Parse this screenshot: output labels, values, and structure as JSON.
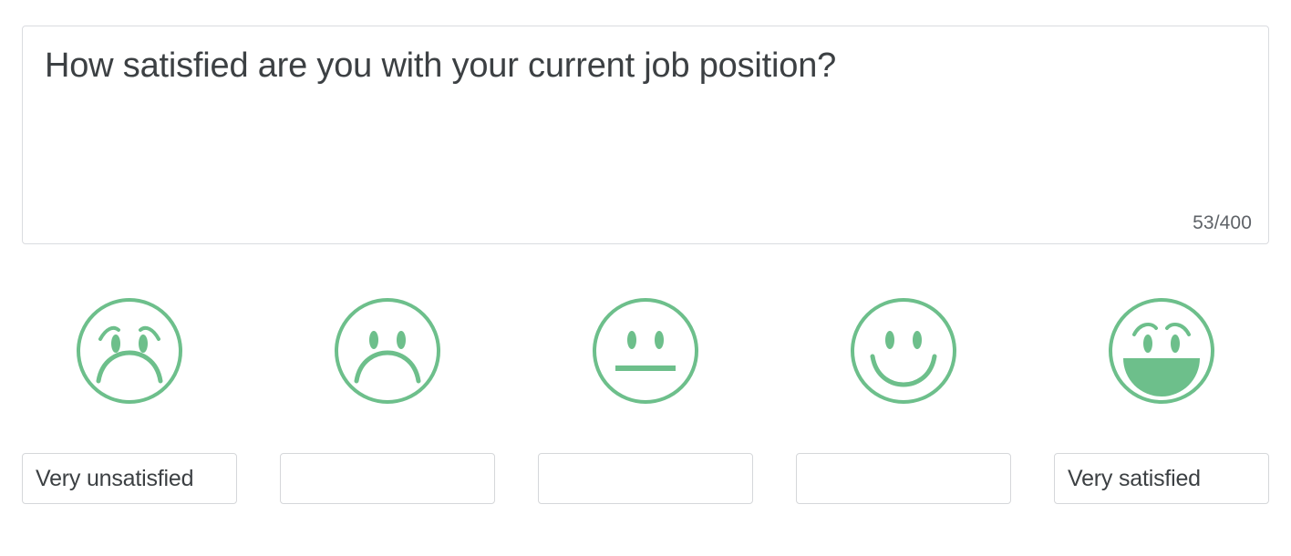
{
  "question": {
    "text": "How satisfied are you with your current job position?",
    "char_counter": "53/400",
    "placeholder": "Enter your question"
  },
  "colors": {
    "face_green": "#6dbf8b",
    "text_dark": "#3c4043",
    "border_gray": "#dadce0",
    "counter_gray": "#5f6368"
  },
  "scale": {
    "points": [
      {
        "icon": "face-very-unsatisfied-icon",
        "label_value": "Very unsatisfied",
        "label_placeholder": ""
      },
      {
        "icon": "face-unsatisfied-icon",
        "label_value": "",
        "label_placeholder": ""
      },
      {
        "icon": "face-neutral-icon",
        "label_value": "",
        "label_placeholder": ""
      },
      {
        "icon": "face-satisfied-icon",
        "label_value": "",
        "label_placeholder": ""
      },
      {
        "icon": "face-very-satisfied-icon",
        "label_value": "Very satisfied",
        "label_placeholder": ""
      }
    ]
  }
}
